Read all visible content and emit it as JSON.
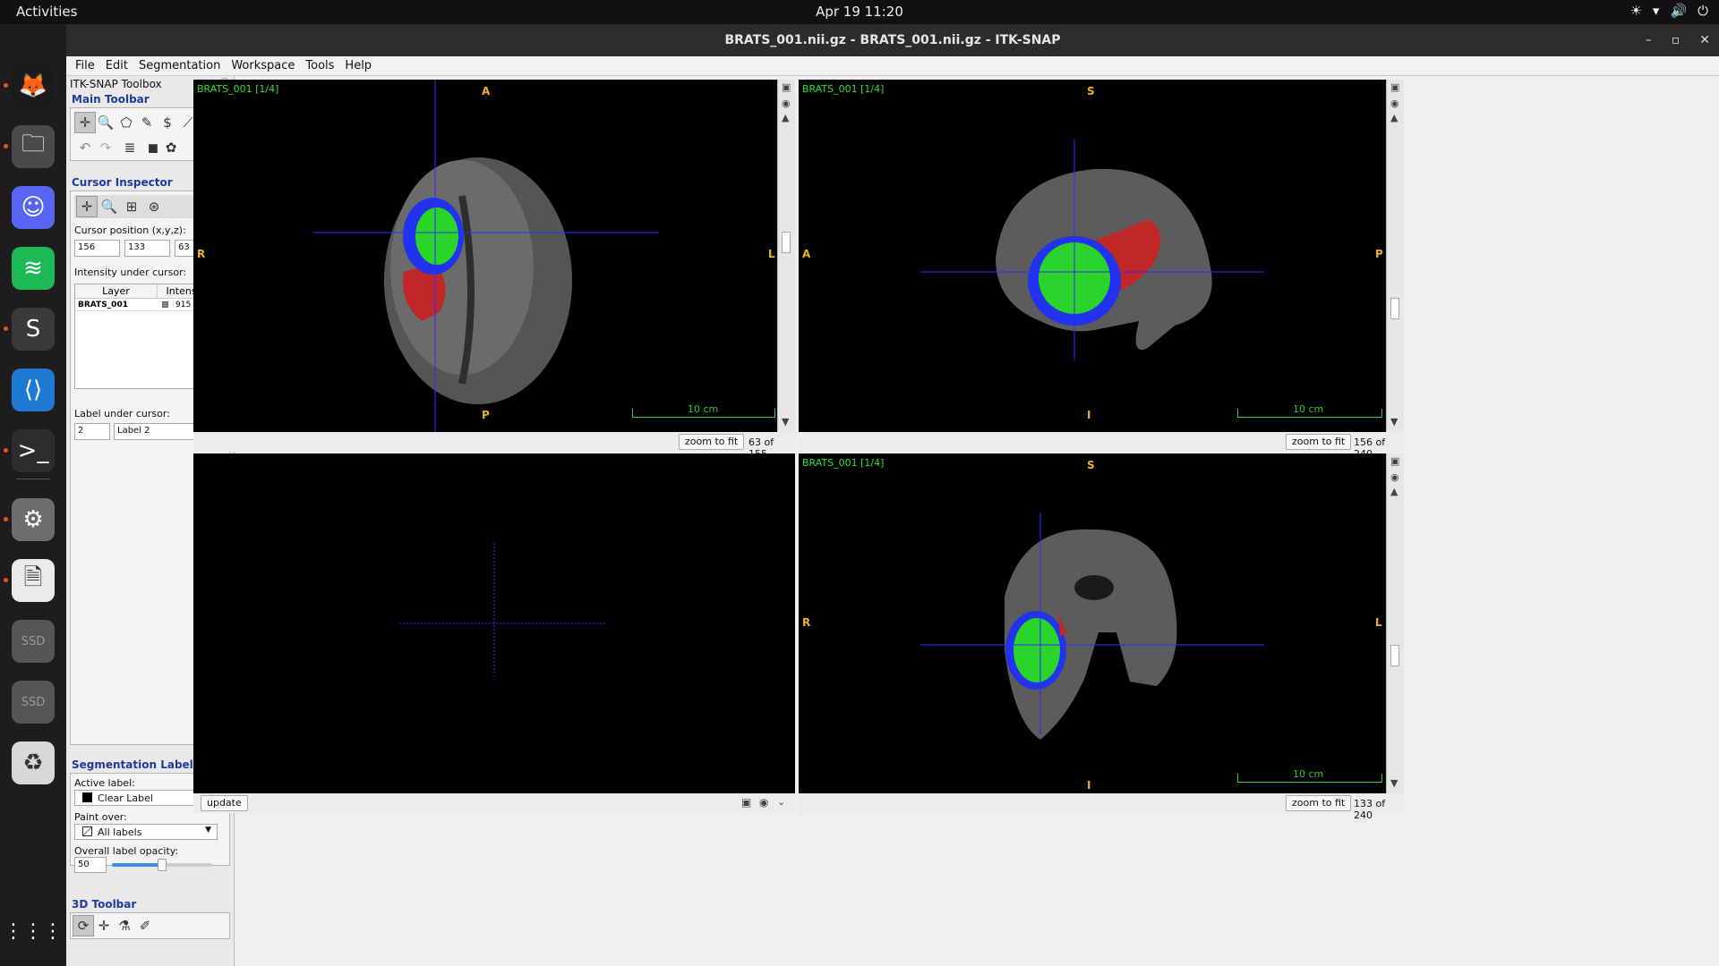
{
  "topbar": {
    "activities": "Activities",
    "clock": "Apr 19  11:20",
    "tray_icons": [
      "☀",
      "▾",
      "🔊",
      "⏻"
    ]
  },
  "dock": {
    "apps": [
      {
        "name": "firefox-icon",
        "glyph": "🦊",
        "bg": "#1b1b1b"
      },
      {
        "name": "files-icon",
        "glyph": "🗀",
        "bg": "#4a4a4a"
      },
      {
        "name": "discord-icon",
        "glyph": "☺",
        "bg": "#5865f2"
      },
      {
        "name": "spotify-icon",
        "glyph": "≋",
        "bg": "#1db954"
      },
      {
        "name": "sublime-icon",
        "glyph": "S",
        "bg": "#3a3a3a"
      },
      {
        "name": "vscode-icon",
        "glyph": "⟨⟩",
        "bg": "#1f7ad6"
      },
      {
        "name": "terminal-icon",
        "glyph": ">_",
        "bg": "#2d2d2d"
      },
      {
        "name": "settings-icon",
        "glyph": "⚙",
        "bg": "#6d6d6d"
      },
      {
        "name": "document-viewer-icon",
        "glyph": "🗎",
        "bg": "#eaeaea"
      },
      {
        "name": "ssd-drive-icon",
        "glyph": "SSD",
        "bg": "#555"
      },
      {
        "name": "ssd-drive-2-icon",
        "glyph": "SSD",
        "bg": "#555"
      },
      {
        "name": "trash-icon",
        "glyph": "♻",
        "bg": "#d8d8d8"
      }
    ],
    "grid": "⋮⋮⋮"
  },
  "window": {
    "title": "BRATS_001.nii.gz - BRATS_001.nii.gz - ITK-SNAP",
    "controls": [
      "–",
      "▫",
      "✕"
    ],
    "menu": [
      "File",
      "Edit",
      "Segmentation",
      "Workspace",
      "Tools",
      "Help"
    ]
  },
  "toolbox": {
    "title": "ITK-SNAP Toolbox",
    "main_toolbar": "Main Toolbar",
    "cursor_inspector": {
      "title": "Cursor Inspector",
      "position_label": "Cursor position (x,y,z):",
      "x": "156",
      "y": "133",
      "z": "63",
      "intensity_label": "Intensity under cursor:",
      "col_layer": "Layer",
      "col_intensity": "Intensity",
      "row_layer": "BRATS_001",
      "row_value": "915",
      "label_under_cursor": "Label under cursor:",
      "label_id": "2",
      "label_name": "Label 2"
    },
    "segmentation": {
      "title": "Segmentation Labels",
      "active_label": "Active label:",
      "active_value": "Clear Label",
      "paint_over": "Paint over:",
      "paint_value": "All labels",
      "opacity_label": "Overall label opacity:",
      "opacity_value": "50",
      "opacity_fraction": 0.5
    },
    "toolbar_3d": "3D Toolbar"
  },
  "views": {
    "axial": {
      "label": "BRATS_001 [1/4]",
      "top": "A",
      "bottom": "P",
      "left": "R",
      "right": "L",
      "scale": "10 cm",
      "zoom": "zoom to fit",
      "slice": "63 of 155"
    },
    "sagittal": {
      "label": "BRATS_001 [1/4]",
      "top": "S",
      "bottom": "I",
      "left": "A",
      "right": "P",
      "scale": "10 cm",
      "zoom": "zoom to fit",
      "slice": "156 of 240"
    },
    "coronal": {
      "label": "BRATS_001 [1/4]",
      "top": "S",
      "bottom": "I",
      "left": "R",
      "right": "L",
      "scale": "10 cm",
      "zoom": "zoom to fit",
      "slice": "133 of 240"
    },
    "three_d": {
      "update": "update"
    }
  },
  "colors": {
    "label_green": "#2bd42b",
    "label_blue": "#2233ee",
    "label_red": "#cc2a2a",
    "crosshair": "#2d2dff"
  }
}
